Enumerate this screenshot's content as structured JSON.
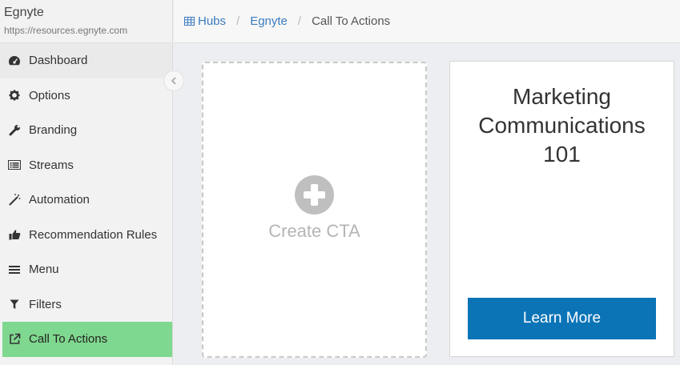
{
  "sidebar": {
    "brand_name": "Egnyte",
    "brand_url": "https://resources.egnyte.com",
    "items": [
      {
        "label": "Dashboard",
        "icon": "dashboard-icon"
      },
      {
        "label": "Options",
        "icon": "gear-icon"
      },
      {
        "label": "Branding",
        "icon": "wrench-icon"
      },
      {
        "label": "Streams",
        "icon": "list-icon"
      },
      {
        "label": "Automation",
        "icon": "magic-wand-icon"
      },
      {
        "label": "Recommendation Rules",
        "icon": "thumbs-up-icon"
      },
      {
        "label": "Menu",
        "icon": "bars-icon"
      },
      {
        "label": "Filters",
        "icon": "filter-icon"
      },
      {
        "label": "Call To Actions",
        "icon": "external-link-icon",
        "active": true
      }
    ],
    "active_color": "#7fd88f"
  },
  "breadcrumb": {
    "hubs": "Hubs",
    "egnyte": "Egnyte",
    "current": "Call To Actions",
    "separator": "/"
  },
  "create_card": {
    "label": "Create CTA"
  },
  "cta_card": {
    "title": "Marketing Communications 101",
    "button_label": "Learn More",
    "button_color": "#0b74b7"
  }
}
